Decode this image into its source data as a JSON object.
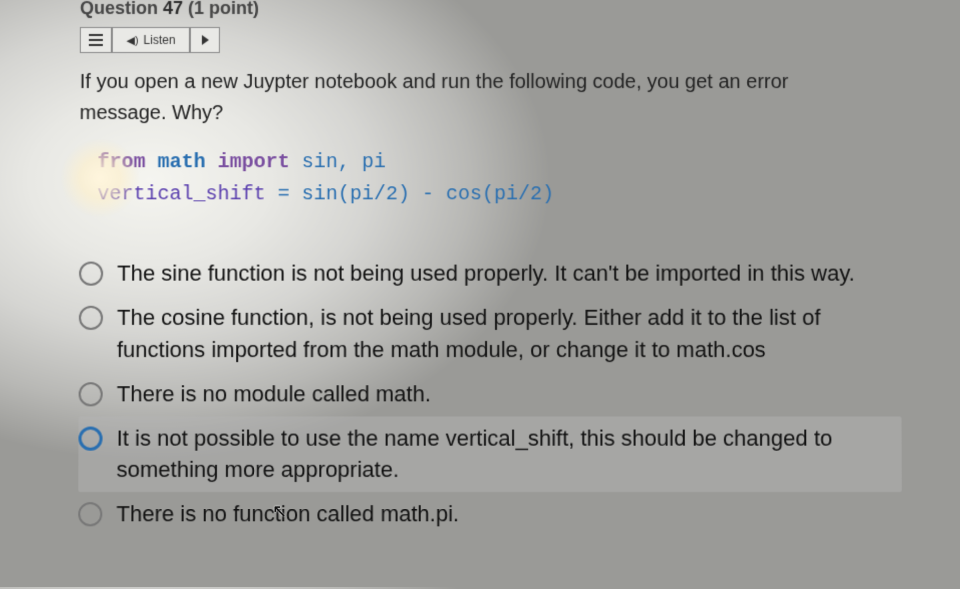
{
  "header": {
    "prefix": "Question",
    "number": "47",
    "points": "(1 point)"
  },
  "toolbar": {
    "listen_label": "Listen"
  },
  "prompt": "If you open a new Juypter notebook and run the following code, you get an error message.  Why?",
  "code": {
    "kw_from": "from",
    "module": "math",
    "kw_import": "import",
    "imports": "sin, pi",
    "line2_var": "vertical_shift",
    "line2_rest": " = sin(pi/2) - cos(pi/2)"
  },
  "options": [
    "The sine function is not being used properly.  It can't be imported in this way.",
    "The cosine function, is not being used properly.  Either add it to the list of functions imported from the math module, or change it to math.cos",
    "There is no module called math.",
    "It is not possible to use the name vertical_shift, this should be changed to something more appropriate.",
    "There is no function called math.pi."
  ]
}
